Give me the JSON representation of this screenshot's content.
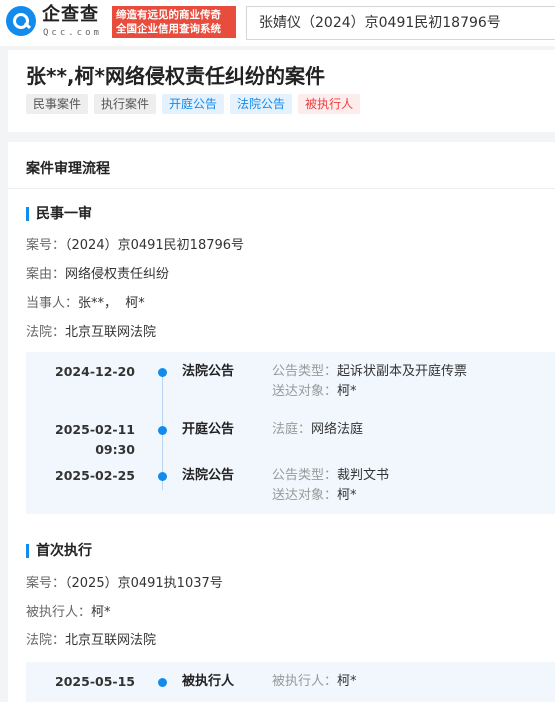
{
  "header": {
    "brand": "企查查",
    "brand_sub": "Qcc.com",
    "slogan_line1": "缔造有远见的商业传奇",
    "slogan_line2": "全国企业信用查询系统",
    "search_value": "张婧仪（2024）京0491民初18796号"
  },
  "case": {
    "title": "张**,柯*网络侵权责任纠纷的案件",
    "tags": [
      "民事案件",
      "执行案件",
      "开庭公告",
      "法院公告",
      "被执行人"
    ]
  },
  "process": {
    "section_title": "案件审理流程",
    "civil": {
      "title": "民事一审",
      "case_no_label": "案号：",
      "case_no": "（2024）京0491民初18796号",
      "cause_label": "案由：",
      "cause": "网络侵权责任纠纷",
      "parties_label": "当事人：",
      "parties": "张**，  柯*",
      "court_label": "法院：",
      "court": "北京互联网法院",
      "timeline": [
        {
          "date": "2024-12-20",
          "type": "法院公告",
          "k1": "公告类型：",
          "v1": "起诉状副本及开庭传票",
          "k2": "送达对象：",
          "v2": "柯*"
        },
        {
          "date": "2025-02-11",
          "time": "09:30",
          "type": "开庭公告",
          "k1": "法庭：",
          "v1": "网络法庭"
        },
        {
          "date": "2025-02-25",
          "type": "法院公告",
          "k1": "公告类型：",
          "v1": "裁判文书",
          "k2": "送达对象：",
          "v2": "柯*"
        }
      ]
    },
    "exec": {
      "title": "首次执行",
      "case_no_label": "案号：",
      "case_no": "（2025）京0491执1037号",
      "debtor_label": "被执行人：",
      "debtor": "柯*",
      "court_label": "法院：",
      "court": "北京互联网法院",
      "timeline": [
        {
          "date": "2025-05-15",
          "type": "被执行人",
          "k1": "被执行人：",
          "v1": "柯*"
        }
      ]
    }
  }
}
